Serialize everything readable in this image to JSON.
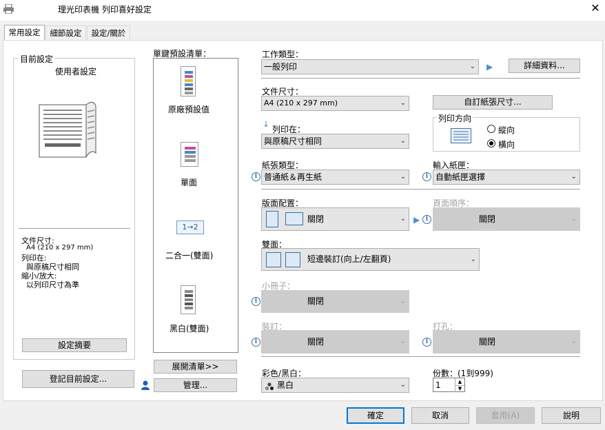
{
  "window": {
    "title": "理光印表機 列印喜好設定",
    "close": "✕"
  },
  "tabs": [
    {
      "label": "常用設定"
    },
    {
      "label": "細節設定"
    },
    {
      "label": "設定/關於"
    }
  ],
  "current": {
    "group_label": "目前設定",
    "user_setting": "使用者設定",
    "summary": {
      "doc_size_label": "文件尺寸:",
      "doc_size_value": "A4 (210 x 297 mm)",
      "print_on_label": "列印在:",
      "print_on_value": "與原稿尺寸相同",
      "scale_label": "縮小/放大:",
      "scale_value": "以列印尺寸為準"
    },
    "summary_button": "設定摘要",
    "register_button": "登記目前設定..."
  },
  "presets": {
    "label": "單鍵預設清單：",
    "items": [
      {
        "label": "原廠預設值"
      },
      {
        "label": "單面"
      },
      {
        "label": "二合一(雙面)"
      },
      {
        "label": "黑白(雙面)"
      }
    ],
    "expand_button": "展開清單>>",
    "manage_button": "管理..."
  },
  "job_type": {
    "label": "工作類型：",
    "value": "一般列印",
    "details_button": "詳細資料..."
  },
  "doc_size": {
    "label": "文件尺寸：",
    "value": "A4 (210 x 297 mm)",
    "custom_button": "自訂紙張尺寸..."
  },
  "print_on": {
    "label": "列印在：",
    "value": "與原稿尺寸相同"
  },
  "orientation": {
    "label": "列印方向",
    "portrait": "縱向",
    "landscape": "橫向",
    "selected": "landscape"
  },
  "paper_type": {
    "label": "紙張類型：",
    "value": "普通紙＆再生紙"
  },
  "input_tray": {
    "label": "輸入紙匣：",
    "value": "自動紙匣選擇"
  },
  "layout": {
    "label": "版面配置：",
    "value": "關閉"
  },
  "page_order": {
    "label": "頁面順序：",
    "value": "關閉"
  },
  "duplex": {
    "label": "雙面：",
    "value": "短邊裝訂(向上/左翻頁)"
  },
  "booklet": {
    "label": "小冊子：",
    "value": "關閉"
  },
  "staple": {
    "label": "裝訂：",
    "value": "關閉"
  },
  "punch": {
    "label": "打孔：",
    "value": "關閉"
  },
  "color": {
    "label": "彩色/黑白：",
    "value": "黑白"
  },
  "copies": {
    "label": "份數：(1到999)",
    "value": "1"
  },
  "footer": {
    "ok": "確定",
    "cancel": "取消",
    "apply": "套用(A)",
    "help": "說明"
  },
  "icon_glyphs": {
    "info": "i",
    "arrow": "▶",
    "down": "⌄",
    "copies_flow": "1→2",
    "print_on_arrow": "↓"
  }
}
